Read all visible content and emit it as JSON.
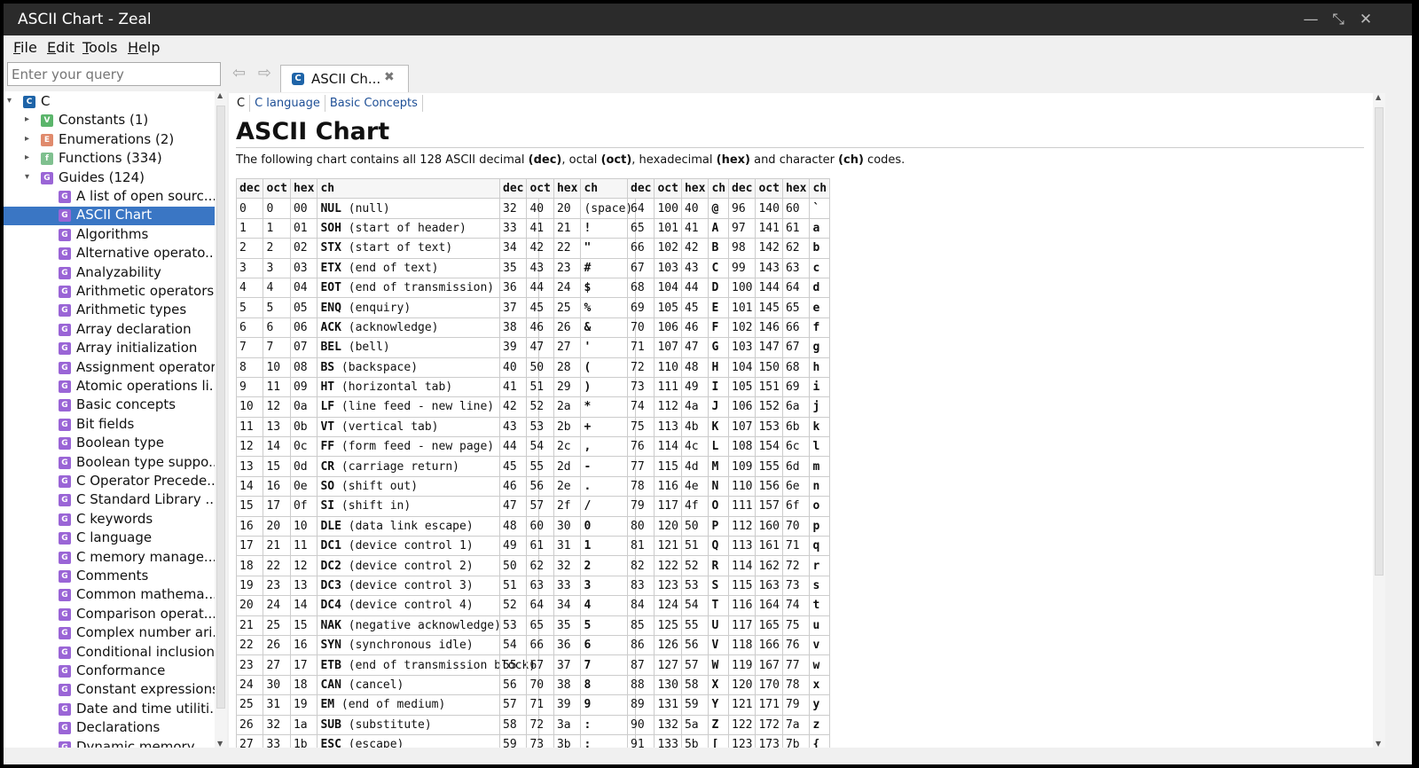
{
  "window": {
    "title": "ASCII Chart - Zeal"
  },
  "menu": [
    {
      "underline": "F",
      "rest": "ile"
    },
    {
      "underline": "E",
      "rest": "dit"
    },
    {
      "underline": "T",
      "rest": "ools"
    },
    {
      "underline": "H",
      "rest": "elp"
    }
  ],
  "search": {
    "placeholder": "Enter your query"
  },
  "tab": {
    "label": "ASCII Ch...",
    "close": "✖"
  },
  "sidebar": {
    "root": {
      "label": "C"
    },
    "categories": [
      {
        "label": "Constants (1)",
        "letter": "V",
        "color": "#5bb56b"
      },
      {
        "label": "Enumerations (2)",
        "letter": "E",
        "color": "#e08a6c"
      },
      {
        "label": "Functions (334)",
        "letter": "f",
        "color": "#7fc08f"
      },
      {
        "label": "Guides (124)",
        "letter": "G",
        "color": "#9a65d6"
      }
    ],
    "guides": [
      "A list of open sourc...",
      "ASCII Chart",
      "Algorithms",
      "Alternative operato...",
      "Analyzability",
      "Arithmetic operators",
      "Arithmetic types",
      "Array declaration",
      "Array initialization",
      "Assignment operators",
      "Atomic operations li...",
      "Basic concepts",
      "Bit fields",
      "Boolean type",
      "Boolean type suppo...",
      "C Operator Precede...",
      "C Standard Library ...",
      "C keywords",
      "C language",
      "C memory manage...",
      "Comments",
      "Common mathema...",
      "Comparison operat...",
      "Complex number ari...",
      "Conditional inclusion",
      "Conformance",
      "Constant expressions",
      "Date and time utiliti...",
      "Declarations",
      "Dynamic memory..."
    ],
    "selected_index": 1
  },
  "breadcrumb": [
    "C",
    "C language",
    "Basic Concepts"
  ],
  "page": {
    "title": "ASCII Chart",
    "intro_parts": [
      "The following chart contains all 128 ASCII decimal ",
      "(dec)",
      ", octal ",
      "(oct)",
      ", hexadecimal ",
      "(hex)",
      " and character ",
      "(ch)",
      " codes."
    ]
  },
  "table": {
    "headers": [
      "dec",
      "oct",
      "hex",
      "ch"
    ],
    "columns": [
      [
        [
          "0",
          "0",
          "00",
          "NUL",
          "(null)"
        ],
        [
          "1",
          "1",
          "01",
          "SOH",
          "(start of header)"
        ],
        [
          "2",
          "2",
          "02",
          "STX",
          "(start of text)"
        ],
        [
          "3",
          "3",
          "03",
          "ETX",
          "(end of text)"
        ],
        [
          "4",
          "4",
          "04",
          "EOT",
          "(end of transmission)"
        ],
        [
          "5",
          "5",
          "05",
          "ENQ",
          "(enquiry)"
        ],
        [
          "6",
          "6",
          "06",
          "ACK",
          "(acknowledge)"
        ],
        [
          "7",
          "7",
          "07",
          "BEL",
          "(bell)"
        ],
        [
          "8",
          "10",
          "08",
          "BS",
          "(backspace)"
        ],
        [
          "9",
          "11",
          "09",
          "HT",
          "(horizontal tab)"
        ],
        [
          "10",
          "12",
          "0a",
          "LF",
          "(line feed - new line)"
        ],
        [
          "11",
          "13",
          "0b",
          "VT",
          "(vertical tab)"
        ],
        [
          "12",
          "14",
          "0c",
          "FF",
          "(form feed - new page)"
        ],
        [
          "13",
          "15",
          "0d",
          "CR",
          "(carriage return)"
        ],
        [
          "14",
          "16",
          "0e",
          "SO",
          "(shift out)"
        ],
        [
          "15",
          "17",
          "0f",
          "SI",
          "(shift in)"
        ],
        [
          "16",
          "20",
          "10",
          "DLE",
          "(data link escape)"
        ],
        [
          "17",
          "21",
          "11",
          "DC1",
          "(device control 1)"
        ],
        [
          "18",
          "22",
          "12",
          "DC2",
          "(device control 2)"
        ],
        [
          "19",
          "23",
          "13",
          "DC3",
          "(device control 3)"
        ],
        [
          "20",
          "24",
          "14",
          "DC4",
          "(device control 4)"
        ],
        [
          "21",
          "25",
          "15",
          "NAK",
          "(negative acknowledge)"
        ],
        [
          "22",
          "26",
          "16",
          "SYN",
          "(synchronous idle)"
        ],
        [
          "23",
          "27",
          "17",
          "ETB",
          "(end of transmission block)"
        ],
        [
          "24",
          "30",
          "18",
          "CAN",
          "(cancel)"
        ],
        [
          "25",
          "31",
          "19",
          "EM",
          "(end of medium)"
        ],
        [
          "26",
          "32",
          "1a",
          "SUB",
          "(substitute)"
        ],
        [
          "27",
          "33",
          "1b",
          "ESC",
          "(escape)"
        ]
      ],
      [
        [
          "32",
          "40",
          "20",
          "",
          "(space)"
        ],
        [
          "33",
          "41",
          "21",
          "!",
          ""
        ],
        [
          "34",
          "42",
          "22",
          "\"",
          ""
        ],
        [
          "35",
          "43",
          "23",
          "#",
          ""
        ],
        [
          "36",
          "44",
          "24",
          "$",
          ""
        ],
        [
          "37",
          "45",
          "25",
          "%",
          ""
        ],
        [
          "38",
          "46",
          "26",
          "&",
          ""
        ],
        [
          "39",
          "47",
          "27",
          "'",
          ""
        ],
        [
          "40",
          "50",
          "28",
          "(",
          ""
        ],
        [
          "41",
          "51",
          "29",
          ")",
          ""
        ],
        [
          "42",
          "52",
          "2a",
          "*",
          ""
        ],
        [
          "43",
          "53",
          "2b",
          "+",
          ""
        ],
        [
          "44",
          "54",
          "2c",
          ",",
          ""
        ],
        [
          "45",
          "55",
          "2d",
          "-",
          ""
        ],
        [
          "46",
          "56",
          "2e",
          ".",
          ""
        ],
        [
          "47",
          "57",
          "2f",
          "/",
          ""
        ],
        [
          "48",
          "60",
          "30",
          "0",
          ""
        ],
        [
          "49",
          "61",
          "31",
          "1",
          ""
        ],
        [
          "50",
          "62",
          "32",
          "2",
          ""
        ],
        [
          "51",
          "63",
          "33",
          "3",
          ""
        ],
        [
          "52",
          "64",
          "34",
          "4",
          ""
        ],
        [
          "53",
          "65",
          "35",
          "5",
          ""
        ],
        [
          "54",
          "66",
          "36",
          "6",
          ""
        ],
        [
          "55",
          "67",
          "37",
          "7",
          ""
        ],
        [
          "56",
          "70",
          "38",
          "8",
          ""
        ],
        [
          "57",
          "71",
          "39",
          "9",
          ""
        ],
        [
          "58",
          "72",
          "3a",
          ":",
          ""
        ],
        [
          "59",
          "73",
          "3b",
          ";",
          ""
        ]
      ],
      [
        [
          "64",
          "100",
          "40",
          "@",
          ""
        ],
        [
          "65",
          "101",
          "41",
          "A",
          ""
        ],
        [
          "66",
          "102",
          "42",
          "B",
          ""
        ],
        [
          "67",
          "103",
          "43",
          "C",
          ""
        ],
        [
          "68",
          "104",
          "44",
          "D",
          ""
        ],
        [
          "69",
          "105",
          "45",
          "E",
          ""
        ],
        [
          "70",
          "106",
          "46",
          "F",
          ""
        ],
        [
          "71",
          "107",
          "47",
          "G",
          ""
        ],
        [
          "72",
          "110",
          "48",
          "H",
          ""
        ],
        [
          "73",
          "111",
          "49",
          "I",
          ""
        ],
        [
          "74",
          "112",
          "4a",
          "J",
          ""
        ],
        [
          "75",
          "113",
          "4b",
          "K",
          ""
        ],
        [
          "76",
          "114",
          "4c",
          "L",
          ""
        ],
        [
          "77",
          "115",
          "4d",
          "M",
          ""
        ],
        [
          "78",
          "116",
          "4e",
          "N",
          ""
        ],
        [
          "79",
          "117",
          "4f",
          "O",
          ""
        ],
        [
          "80",
          "120",
          "50",
          "P",
          ""
        ],
        [
          "81",
          "121",
          "51",
          "Q",
          ""
        ],
        [
          "82",
          "122",
          "52",
          "R",
          ""
        ],
        [
          "83",
          "123",
          "53",
          "S",
          ""
        ],
        [
          "84",
          "124",
          "54",
          "T",
          ""
        ],
        [
          "85",
          "125",
          "55",
          "U",
          ""
        ],
        [
          "86",
          "126",
          "56",
          "V",
          ""
        ],
        [
          "87",
          "127",
          "57",
          "W",
          ""
        ],
        [
          "88",
          "130",
          "58",
          "X",
          ""
        ],
        [
          "89",
          "131",
          "59",
          "Y",
          ""
        ],
        [
          "90",
          "132",
          "5a",
          "Z",
          ""
        ],
        [
          "91",
          "133",
          "5b",
          "[",
          ""
        ]
      ],
      [
        [
          "96",
          "140",
          "60",
          "`",
          ""
        ],
        [
          "97",
          "141",
          "61",
          "a",
          ""
        ],
        [
          "98",
          "142",
          "62",
          "b",
          ""
        ],
        [
          "99",
          "143",
          "63",
          "c",
          ""
        ],
        [
          "100",
          "144",
          "64",
          "d",
          ""
        ],
        [
          "101",
          "145",
          "65",
          "e",
          ""
        ],
        [
          "102",
          "146",
          "66",
          "f",
          ""
        ],
        [
          "103",
          "147",
          "67",
          "g",
          ""
        ],
        [
          "104",
          "150",
          "68",
          "h",
          ""
        ],
        [
          "105",
          "151",
          "69",
          "i",
          ""
        ],
        [
          "106",
          "152",
          "6a",
          "j",
          ""
        ],
        [
          "107",
          "153",
          "6b",
          "k",
          ""
        ],
        [
          "108",
          "154",
          "6c",
          "l",
          ""
        ],
        [
          "109",
          "155",
          "6d",
          "m",
          ""
        ],
        [
          "110",
          "156",
          "6e",
          "n",
          ""
        ],
        [
          "111",
          "157",
          "6f",
          "o",
          ""
        ],
        [
          "112",
          "160",
          "70",
          "p",
          ""
        ],
        [
          "113",
          "161",
          "71",
          "q",
          ""
        ],
        [
          "114",
          "162",
          "72",
          "r",
          ""
        ],
        [
          "115",
          "163",
          "73",
          "s",
          ""
        ],
        [
          "116",
          "164",
          "74",
          "t",
          ""
        ],
        [
          "117",
          "165",
          "75",
          "u",
          ""
        ],
        [
          "118",
          "166",
          "76",
          "v",
          ""
        ],
        [
          "119",
          "167",
          "77",
          "w",
          ""
        ],
        [
          "120",
          "170",
          "78",
          "x",
          ""
        ],
        [
          "121",
          "171",
          "79",
          "y",
          ""
        ],
        [
          "122",
          "172",
          "7a",
          "z",
          ""
        ],
        [
          "123",
          "173",
          "7b",
          "{",
          ""
        ]
      ]
    ]
  },
  "colors": {
    "selection": "#3a76c4",
    "titlebar": "#2b2b2b",
    "link": "#1e4f96"
  }
}
